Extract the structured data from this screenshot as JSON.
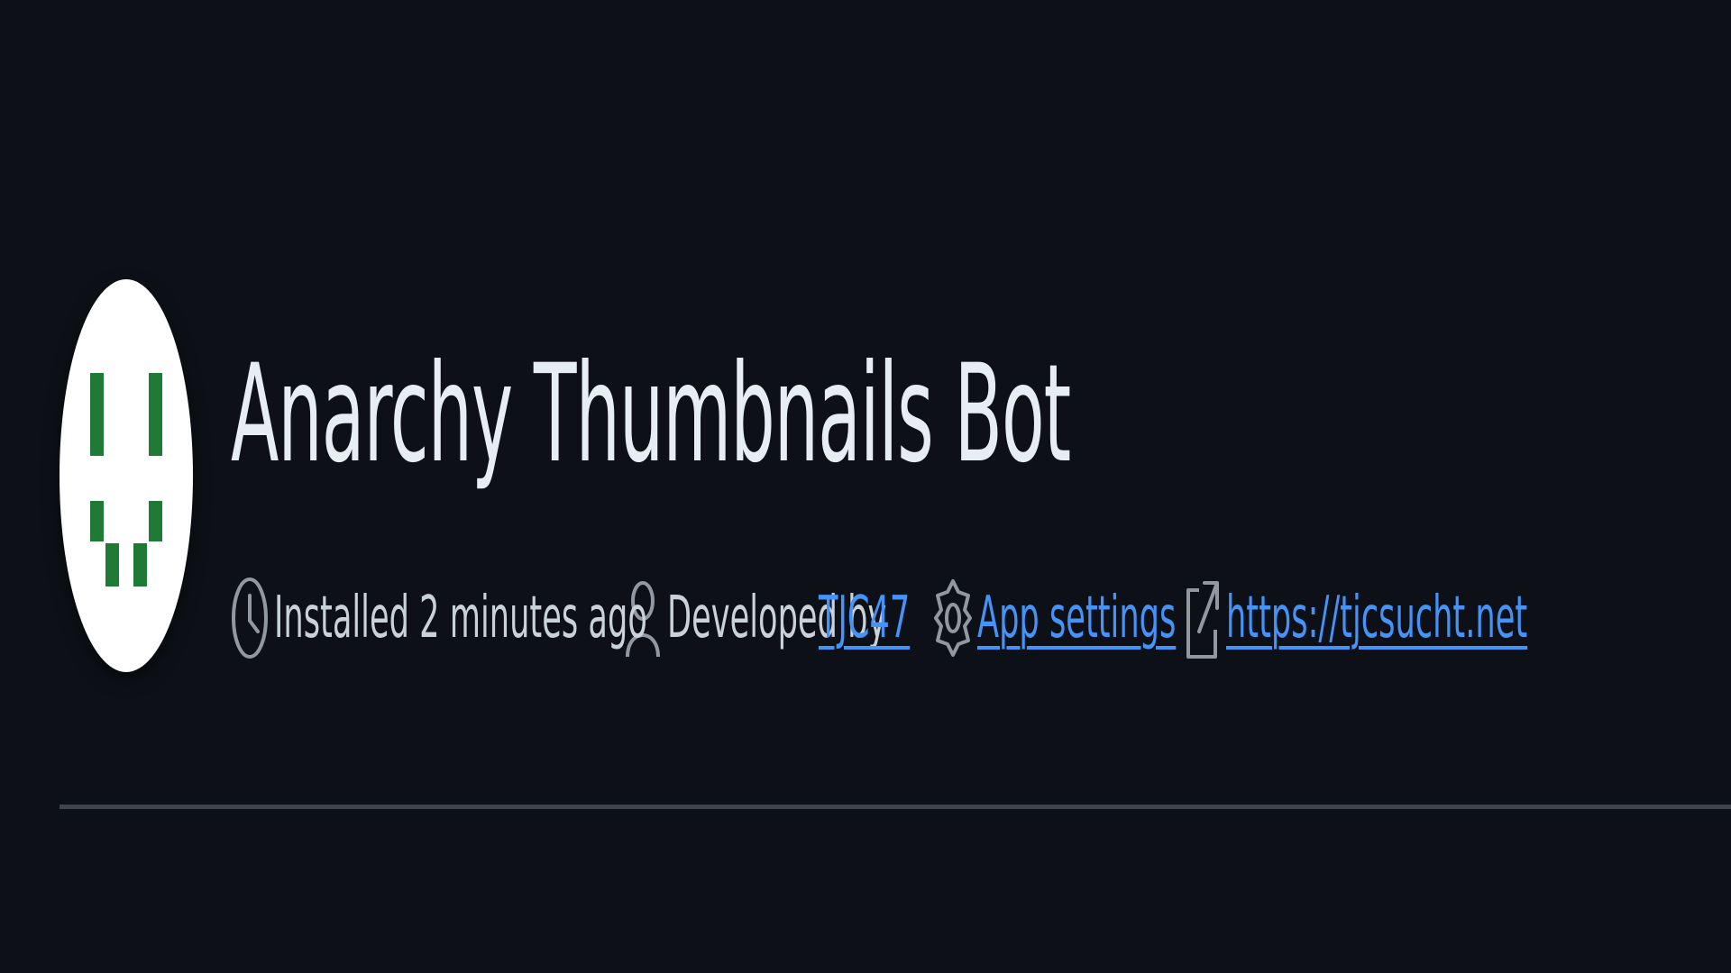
{
  "app": {
    "name": "Anarchy Thumbnails Bot",
    "avatar_icon": "smiley-pixel-icon",
    "avatar_colors": {
      "background": "#ffffff",
      "pixels": "#1f7a35"
    }
  },
  "meta": {
    "installed": {
      "icon": "clock-icon",
      "text": "Installed 2 minutes ago"
    },
    "developer": {
      "icon": "person-icon",
      "prefix": "Developed by",
      "link_text": "TJC47"
    },
    "settings": {
      "icon": "gear-icon",
      "link_text": "App settings"
    },
    "website": {
      "icon": "external-link-icon",
      "link_text": "https://tjcsucht.net"
    }
  },
  "theme": {
    "background": "#0d1117",
    "text": "#e6edf3",
    "muted": "#c9d1d9",
    "link": "#4493f8",
    "divider": "#3d444d"
  }
}
